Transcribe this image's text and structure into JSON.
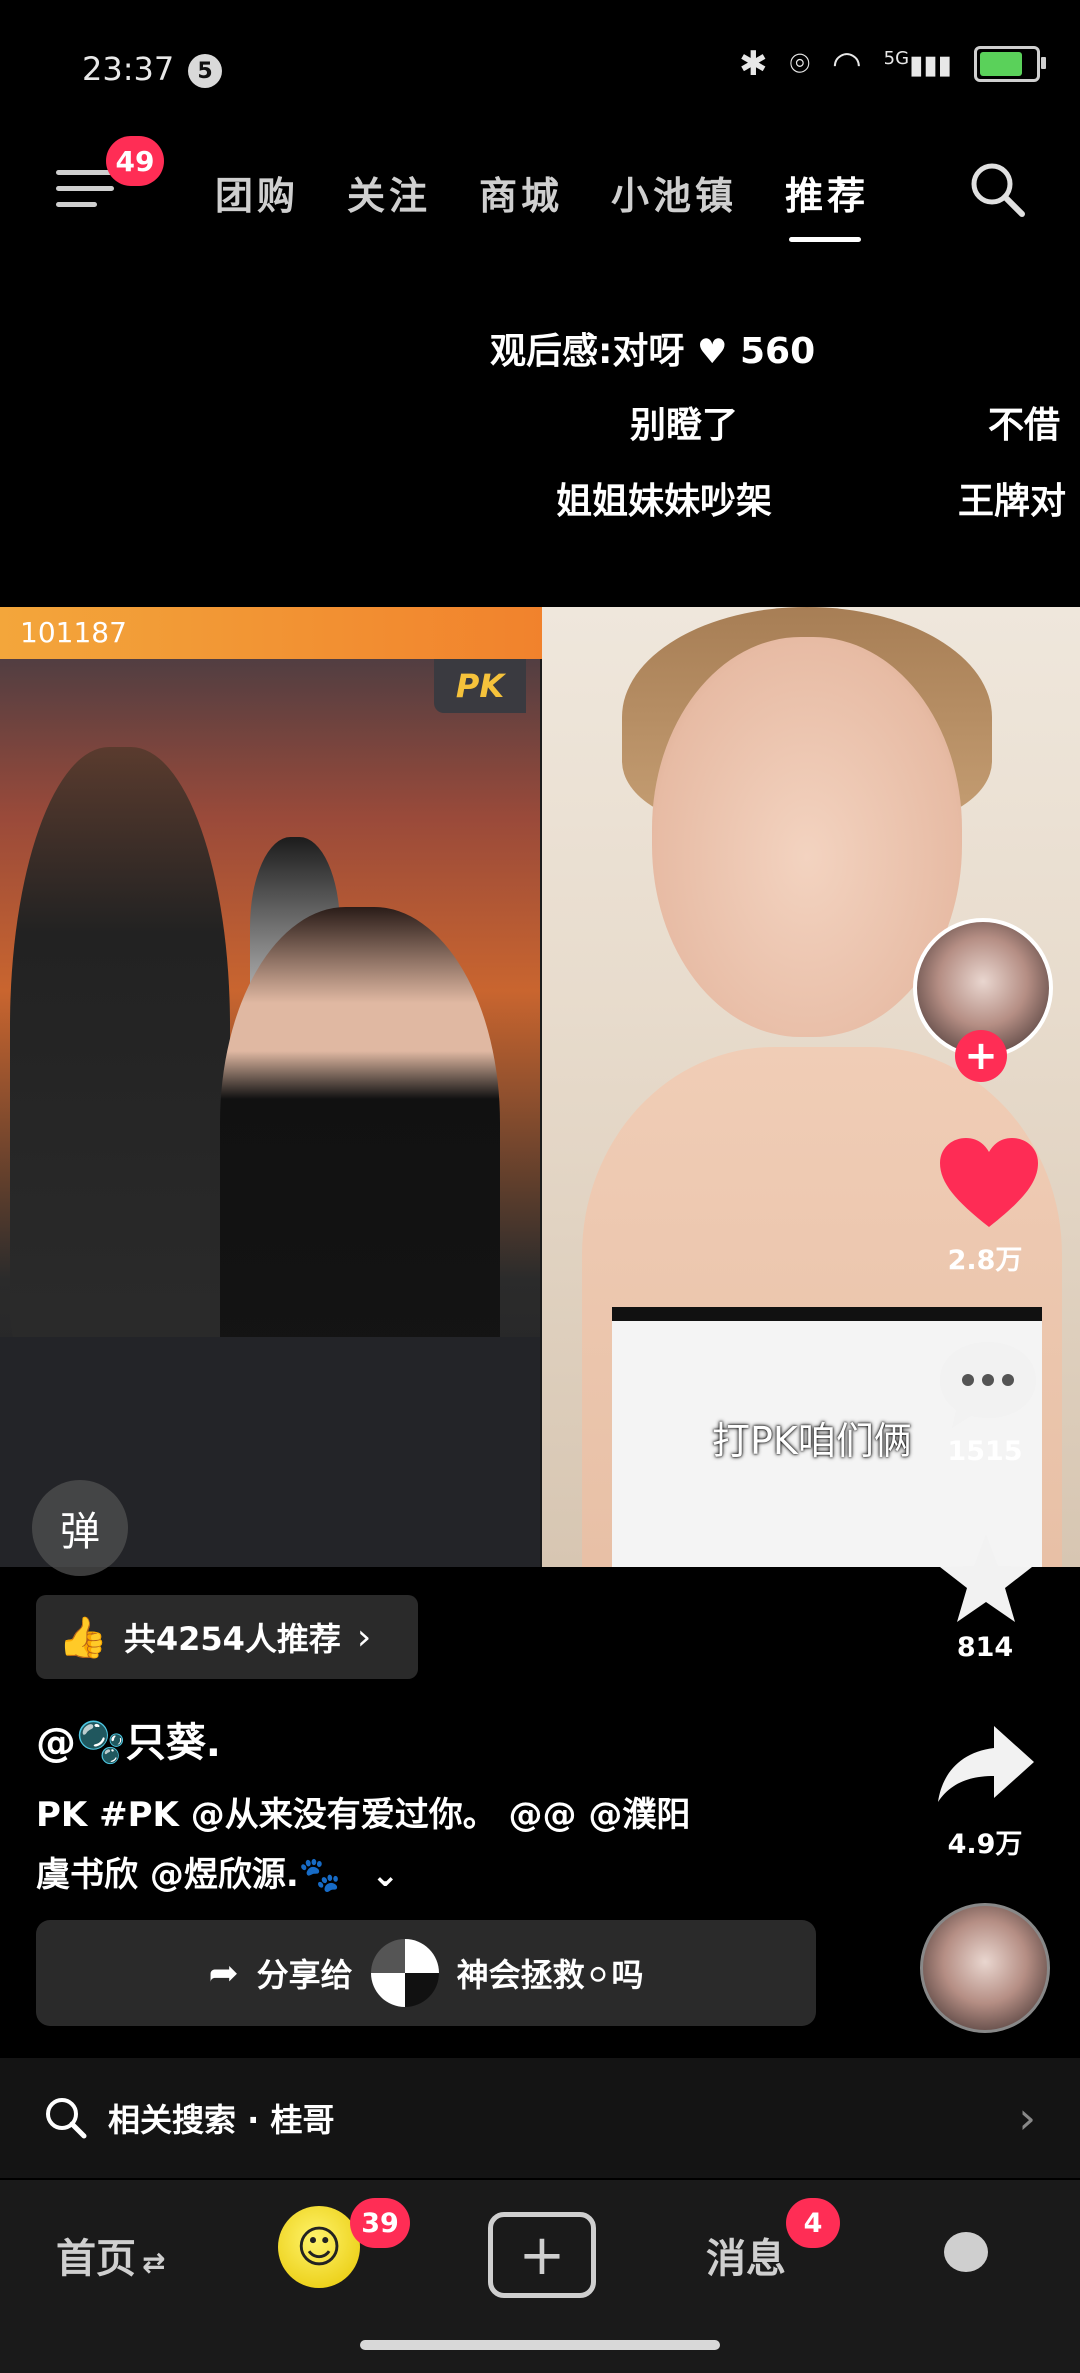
{
  "status_bar": {
    "time": "23:37",
    "notif_count": "5",
    "network": "5G"
  },
  "top_nav": {
    "menu_badge": "49",
    "tabs": [
      {
        "label": "团购"
      },
      {
        "label": "关注"
      },
      {
        "label": "商城"
      },
      {
        "label": "小池镇"
      },
      {
        "label": "推荐"
      }
    ],
    "active_tab": "推荐"
  },
  "danmaku": [
    {
      "text": "观后感:对呀"
    },
    {
      "text": "560"
    },
    {
      "text": "别瞪了"
    },
    {
      "text": "不借"
    },
    {
      "text": "姐姐妹妹吵架"
    },
    {
      "text": "王牌对"
    }
  ],
  "video": {
    "left_banner": "101187",
    "left_logo": "PK",
    "subtitle": "打PK咱们俩",
    "danmu_button": "弹"
  },
  "right_rail": {
    "likes": "2.8万",
    "comments": "1515",
    "favorites": "814",
    "shares": "4.9万"
  },
  "info": {
    "recommend_text": "共4254人推荐",
    "author": "@🫧只葵.",
    "description_line1": "PK #PK @从来没有爱过你。 @@ @濮阳",
    "description_line2": "虞书欣 @煜欣源.🐾",
    "share_prefix": "分享给",
    "share_target": "神会拯救⚪吗"
  },
  "related_search": {
    "label": "相关搜索 · 桂哥"
  },
  "bottom_nav": {
    "home": "首页",
    "home_suffix": "⇄",
    "friends_badge": "39",
    "messages": "消息",
    "messages_badge": "4",
    "plus": "+"
  },
  "colors": {
    "accent": "#ff2d55",
    "background": "#000000",
    "panel": "#2a2a2a"
  }
}
